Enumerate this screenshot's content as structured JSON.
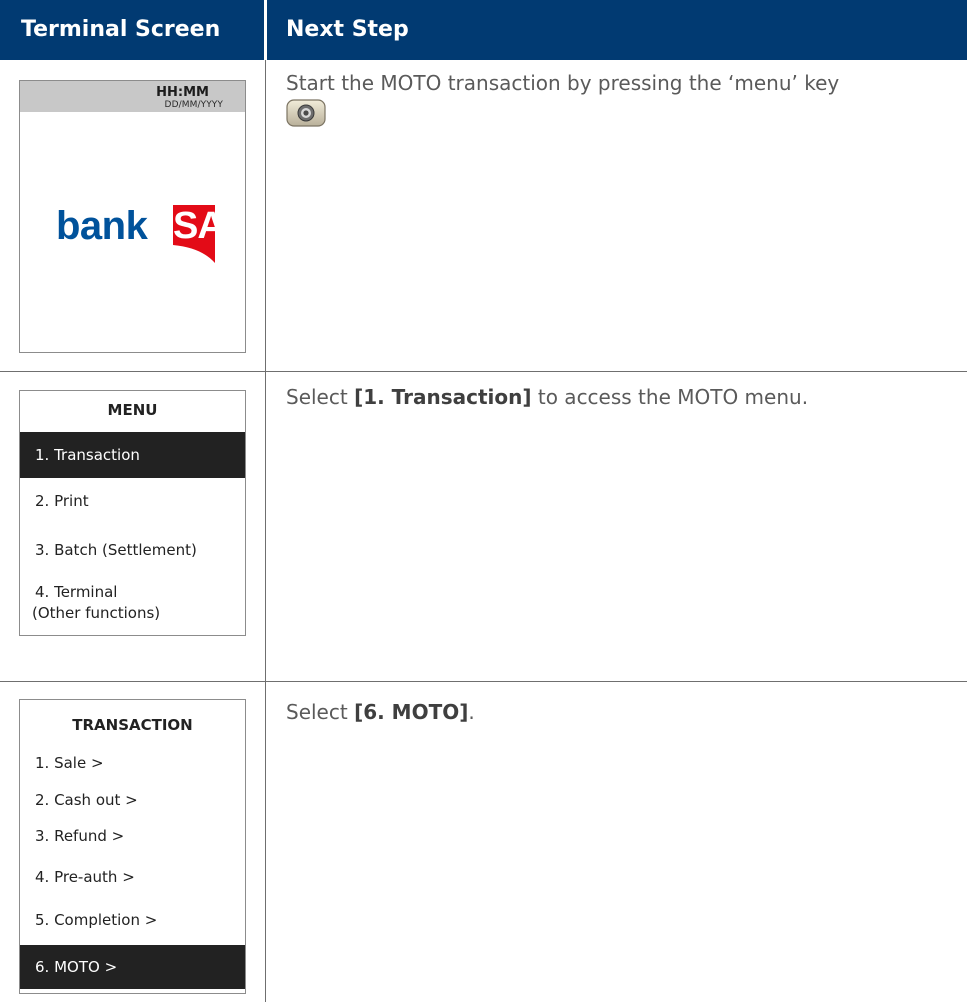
{
  "header": {
    "col1": "Terminal Screen",
    "col2": "Next Step"
  },
  "steps": [
    {
      "screen": {
        "time": "HH:MM",
        "date": "DD/MM/YYYY",
        "logo_word": "bank",
        "logo_badge": "SA"
      },
      "instruction": {
        "line1": "Start the MOTO transaction by pressing the ‘menu’ key"
      },
      "key_icon": "menu-key-icon"
    },
    {
      "screen": {
        "title": "MENU",
        "items": [
          "1. Transaction",
          "2. Print",
          "3. Batch (Settlement)",
          "4. Terminal",
          "(Other functions)"
        ],
        "selected": "1. Transaction"
      },
      "instruction": {
        "before": "Select ",
        "bold": "[1. Transaction]",
        "after": " to access the MOTO menu."
      }
    },
    {
      "screen": {
        "title": "TRANSACTION",
        "items": [
          "1. Sale >",
          "2. Cash out >",
          "3. Refund >",
          "4. Pre-auth >",
          "5. Completion >",
          "6. MOTO >"
        ],
        "selected": "6. MOTO >"
      },
      "instruction": {
        "before": "Select ",
        "bold": "[6. MOTO]",
        "after": "."
      }
    }
  ],
  "colors": {
    "header_bg": "#013a72",
    "logo_blue": "#00529b",
    "logo_red": "#e30b17",
    "selected_bg": "#222222"
  }
}
